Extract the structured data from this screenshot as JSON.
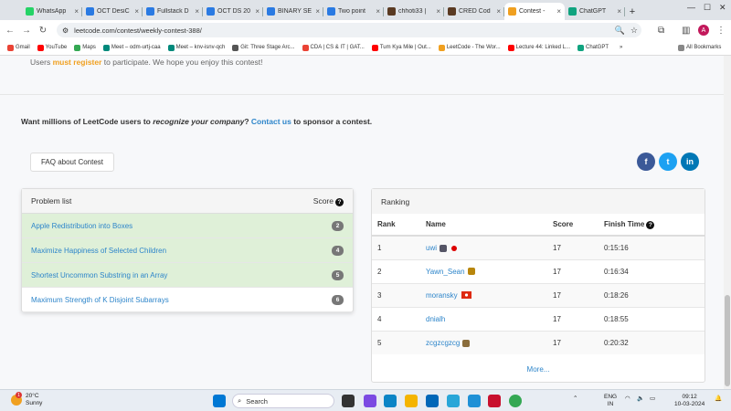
{
  "browser": {
    "tabs": [
      {
        "label": "WhatsApp",
        "color": "#25d366"
      },
      {
        "label": "OCT DesiC",
        "color": "#2a7ae2"
      },
      {
        "label": "Fullstack D",
        "color": "#2a7ae2"
      },
      {
        "label": "OCT DS 20",
        "color": "#2a7ae2"
      },
      {
        "label": "BINARY SE",
        "color": "#2a7ae2"
      },
      {
        "label": "Two point",
        "color": "#2a7ae2"
      },
      {
        "label": "chhoti33 |",
        "color": "#5a3a22"
      },
      {
        "label": "CRED Cod",
        "color": "#5a3a22"
      },
      {
        "label": "Contest -",
        "color": "#f0a020"
      },
      {
        "label": "ChatGPT",
        "color": "#10a37f"
      }
    ],
    "new_tab": "+",
    "url": "leetcode.com/contest/weekly-contest-388/",
    "bookmarks": [
      {
        "label": "Gmail",
        "color": "#ea4335"
      },
      {
        "label": "YouTube",
        "color": "#ff0000"
      },
      {
        "label": "Maps",
        "color": "#34a853"
      },
      {
        "label": "Meet – odm-urtj-caa",
        "color": "#00897b"
      },
      {
        "label": "Meet – knv-isnv-qch",
        "color": "#00897b"
      },
      {
        "label": "Git: Three Stage Arc...",
        "color": "#555"
      },
      {
        "label": "CDA | CS & IT | GAT...",
        "color": "#ea4335"
      },
      {
        "label": "Tum Kya Mile | Out...",
        "color": "#ff0000"
      },
      {
        "label": "LeetCode - The Wor...",
        "color": "#f0a020"
      },
      {
        "label": "Lecture 44: Linked L...",
        "color": "#ff0000"
      },
      {
        "label": "ChatGPT",
        "color": "#10a37f"
      }
    ],
    "bookmarks_more": "»",
    "all_bookmarks": "All Bookmarks"
  },
  "page": {
    "intro_pre": "Users ",
    "intro_bold": "must register",
    "intro_post": " to participate. We hope you enjoy this contest!",
    "sponsor_pre": "Want millions of LeetCode users to ",
    "sponsor_em": "recognize your company",
    "sponsor_mid": "? ",
    "sponsor_link": "Contact us",
    "sponsor_post": " to sponsor a contest.",
    "faq_button": "FAQ about Contest",
    "social": [
      {
        "label": "f",
        "color": "#3b5998"
      },
      {
        "label": "t",
        "color": "#1da1f2"
      },
      {
        "label": "in",
        "color": "#0077b5"
      }
    ]
  },
  "problems": {
    "header": "Problem list",
    "score_header": "Score",
    "items": [
      {
        "title": "Apple Redistribution into Boxes",
        "score": "2",
        "solved": true
      },
      {
        "title": "Maximize Happiness of Selected Children",
        "score": "4",
        "solved": true
      },
      {
        "title": "Shortest Uncommon Substring in an Array",
        "score": "5",
        "solved": true
      },
      {
        "title": "Maximum Strength of K Disjoint Subarrays",
        "score": "6",
        "solved": false
      }
    ]
  },
  "ranking": {
    "header": "Ranking",
    "columns": [
      "Rank",
      "Name",
      "Score",
      "Finish Time"
    ],
    "rows": [
      {
        "rank": "1",
        "name": "uwi",
        "score": "17",
        "time": "0:15:16"
      },
      {
        "rank": "2",
        "name": "Yawn_Sean",
        "score": "17",
        "time": "0:16:34"
      },
      {
        "rank": "3",
        "name": "moransky",
        "score": "17",
        "time": "0:18:26"
      },
      {
        "rank": "4",
        "name": "dnialh",
        "score": "17",
        "time": "0:18:55"
      },
      {
        "rank": "5",
        "name": "zcgzcgzcg",
        "score": "17",
        "time": "0:20:32"
      }
    ],
    "more": "More..."
  },
  "taskbar": {
    "temp": "20°C",
    "condition": "Sunny",
    "notif": "1",
    "search": "Search",
    "lang1": "ENG",
    "lang2": "IN",
    "time": "09:12",
    "date": "10-03-2024"
  }
}
